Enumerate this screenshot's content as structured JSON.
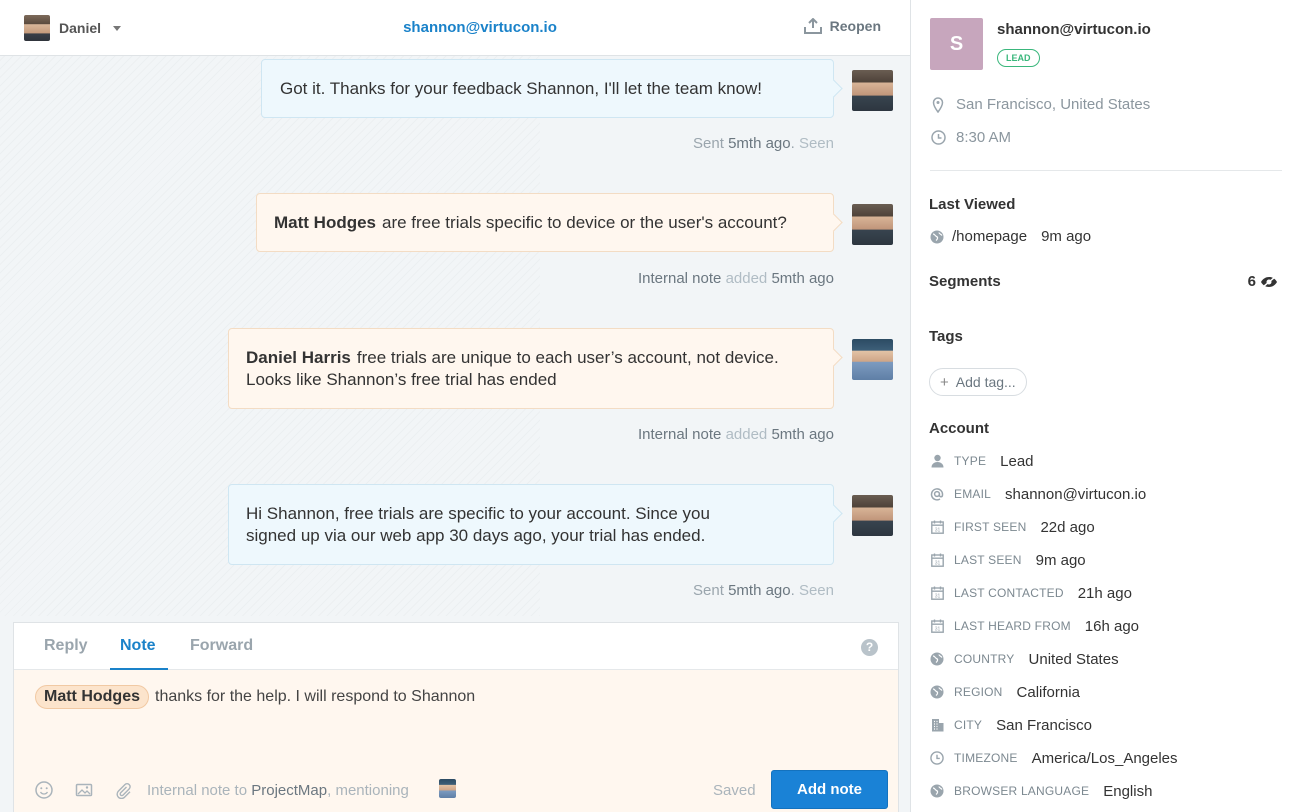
{
  "header": {
    "assignee": "Daniel",
    "email": "shannon@virtucon.io",
    "reopen_label": "Reopen"
  },
  "messages": [
    {
      "kind": "reply",
      "text": "Got it. Thanks for your feedback Shannon, I'll let the team know!",
      "meta": {
        "prefix": "Sent",
        "time": "5mth ago",
        "suffix": "Seen"
      }
    },
    {
      "kind": "note",
      "mention": "Matt Hodges",
      "text": "are free trials specific to device or the user's account?",
      "meta": {
        "prefix": "Internal note",
        "mid": "added",
        "time": "5mth ago"
      }
    },
    {
      "kind": "note",
      "mention": "Daniel Harris",
      "text": "free trials are unique to each user’s account, not device. Looks like Shannon’s free trial has ended",
      "meta": {
        "prefix": "Internal note",
        "mid": "added",
        "time": "5mth ago"
      }
    },
    {
      "kind": "reply",
      "text": "Hi Shannon, free trials are specific to your account. Since you signed up via our web app 30 days ago, your trial has ended.",
      "meta": {
        "prefix": "Sent",
        "time": "5mth ago",
        "suffix": "Seen"
      }
    }
  ],
  "composer": {
    "tabs": [
      "Reply",
      "Note",
      "Forward"
    ],
    "active_tab": "Note",
    "help": "?",
    "mention": "Matt Hodges",
    "text": "thanks for the help. I will respond to Shannon",
    "footer_prefix": "Internal note to",
    "footer_app": "ProjectMap",
    "footer_suffix": ", mentioning",
    "saved": "Saved",
    "add_note_label": "Add note"
  },
  "profile": {
    "avatar_letter": "S",
    "email": "shannon@virtucon.io",
    "badge": "LEAD",
    "location": "San Francisco, United States",
    "local_time": "8:30 AM",
    "last_viewed_title": "Last Viewed",
    "last_viewed_page": "/homepage",
    "last_viewed_ago": "9m ago",
    "segments_title": "Segments",
    "segments_count": "6",
    "tags_title": "Tags",
    "add_tag_label": "Add tag...",
    "account_title": "Account",
    "attributes": [
      {
        "key": "TYPE",
        "value": "Lead",
        "icon": "user-icon"
      },
      {
        "key": "EMAIL",
        "value": "shannon@virtucon.io",
        "icon": "at-icon"
      },
      {
        "key": "FIRST SEEN",
        "value": "22d ago",
        "icon": "calendar-icon"
      },
      {
        "key": "LAST SEEN",
        "value": "9m ago",
        "icon": "calendar-icon"
      },
      {
        "key": "LAST CONTACTED",
        "value": "21h ago",
        "icon": "calendar-icon"
      },
      {
        "key": "LAST HEARD FROM",
        "value": "16h ago",
        "icon": "calendar-icon"
      },
      {
        "key": "COUNTRY",
        "value": "United States",
        "icon": "globe-icon"
      },
      {
        "key": "REGION",
        "value": "California",
        "icon": "globe-icon"
      },
      {
        "key": "CITY",
        "value": "San Francisco",
        "icon": "building-icon"
      },
      {
        "key": "TIMEZONE",
        "value": "America/Los_Angeles",
        "icon": "clock-icon"
      },
      {
        "key": "BROWSER LANGUAGE",
        "value": "English",
        "icon": "globe-icon"
      }
    ]
  },
  "colors": {
    "accent": "#1a82c9",
    "lead_badge": "#3ab77c",
    "note_bg": "#fff7ef",
    "reply_bg": "#eef8fd"
  }
}
